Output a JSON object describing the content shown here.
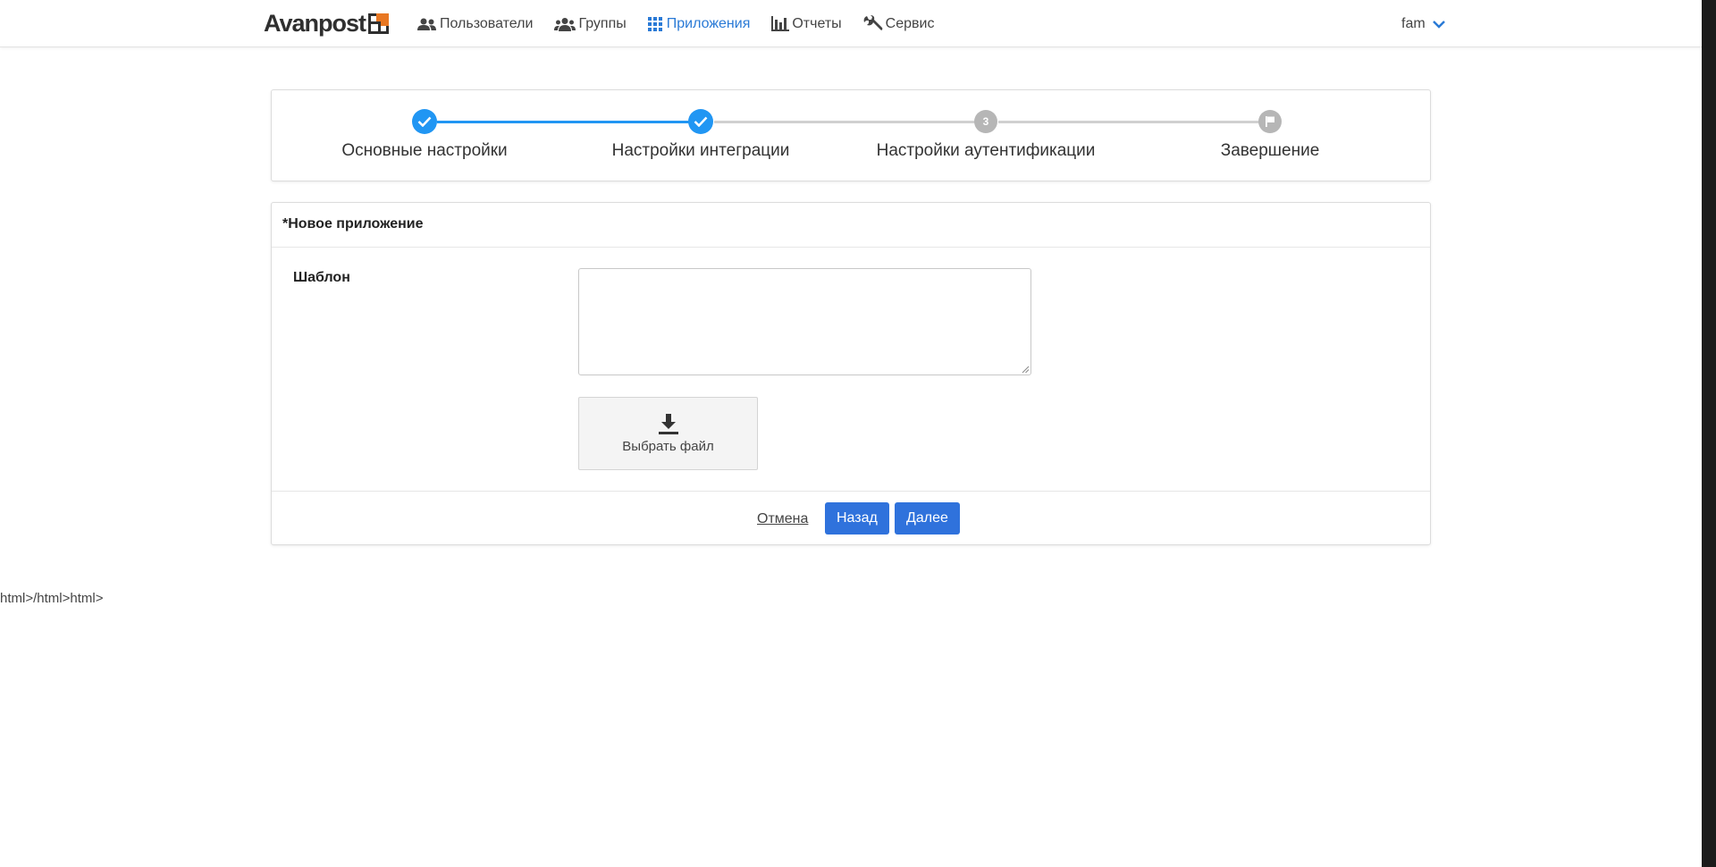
{
  "header": {
    "logo_text": "Avanpost",
    "brand_color": "#e87722",
    "nav": [
      {
        "label": "Пользователи",
        "icon": "users-icon",
        "active": false
      },
      {
        "label": "Группы",
        "icon": "groups-icon",
        "active": false
      },
      {
        "label": "Приложения",
        "icon": "apps-grid-icon",
        "active": true
      },
      {
        "label": "Отчеты",
        "icon": "bar-chart-icon",
        "active": false
      },
      {
        "label": "Сервис",
        "icon": "wrench-icon",
        "active": false
      }
    ],
    "user": "fam",
    "accent_color": "#2a7ad6"
  },
  "stepper": {
    "steps": [
      {
        "label": "Основные настройки",
        "state": "done"
      },
      {
        "label": "Настройки интеграции",
        "state": "done"
      },
      {
        "label": "Настройки аутентификации",
        "state": "todo",
        "number": "3"
      },
      {
        "label": "Завершение",
        "state": "todo",
        "icon": "flag-icon"
      }
    ],
    "done_color": "#2196f3",
    "todo_color": "#b6b6b6"
  },
  "form": {
    "title": "*Новое приложение",
    "template_label": "Шаблон",
    "template_value": "",
    "file_button_label": "Выбрать файл",
    "cancel_label": "Отмена",
    "back_label": "Назад",
    "next_label": "Далее",
    "button_color": "#2f72dc"
  },
  "stray_text": "html>/html>html>"
}
